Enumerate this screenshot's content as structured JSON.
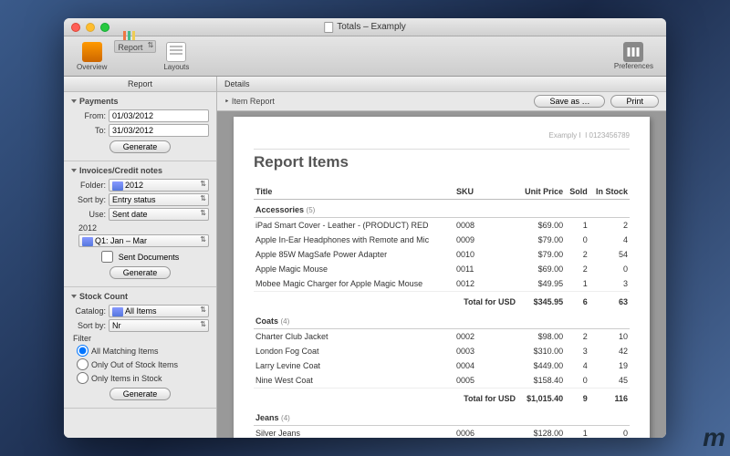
{
  "window": {
    "title": "Totals – Examply"
  },
  "toolbar": {
    "overview": "Overview",
    "report": "Report",
    "layouts": "Layouts",
    "preferences": "Preferences"
  },
  "sidebar": {
    "header": "Report",
    "payments": {
      "title": "Payments",
      "from_label": "From:",
      "from": "01/03/2012",
      "to_label": "To:",
      "to": "31/03/2012",
      "generate": "Generate"
    },
    "invoices": {
      "title": "Invoices/Credit notes",
      "folder_label": "Folder:",
      "folder": "2012",
      "sortby_label": "Sort by:",
      "sortby": "Entry status",
      "use_label": "Use:",
      "use": "Sent date",
      "year": "2012",
      "quarter": "Q1: Jan – Mar",
      "sent_docs": "Sent Documents",
      "generate": "Generate"
    },
    "stock": {
      "title": "Stock Count",
      "catalog_label": "Catalog:",
      "catalog": "All Items",
      "sortby_label": "Sort by:",
      "sortby": "Nr",
      "filter_label": "Filter",
      "opts": [
        "All Matching Items",
        "Only Out of Stock Items",
        "Only Items in Stock"
      ],
      "generate": "Generate"
    }
  },
  "details": {
    "header": "Details",
    "crumb": "Item Report",
    "save_as": "Save as …",
    "print": "Print"
  },
  "report": {
    "company": "Examply I",
    "company_no": "I 0123456789",
    "title": "Report Items",
    "cols": [
      "Title",
      "SKU",
      "Unit Price",
      "Sold",
      "In Stock"
    ],
    "total_label": "Total for USD",
    "groups": [
      {
        "name": "Accessories",
        "count": 5,
        "rows": [
          [
            "iPad Smart Cover - Leather - (PRODUCT) RED",
            "0008",
            "$69.00",
            "1",
            "2"
          ],
          [
            "Apple In-Ear Headphones with Remote and Mic",
            "0009",
            "$79.00",
            "0",
            "4"
          ],
          [
            "Apple 85W MagSafe Power Adapter",
            "0010",
            "$79.00",
            "2",
            "54"
          ],
          [
            "Apple Magic Mouse",
            "0011",
            "$69.00",
            "2",
            "0"
          ],
          [
            "Mobee Magic Charger for Apple Magic Mouse",
            "0012",
            "$49.95",
            "1",
            "3"
          ]
        ],
        "total": [
          "$345.95",
          "6",
          "63"
        ]
      },
      {
        "name": "Coats",
        "count": 4,
        "rows": [
          [
            "Charter Club Jacket",
            "0002",
            "$98.00",
            "2",
            "10"
          ],
          [
            "London Fog Coat",
            "0003",
            "$310.00",
            "3",
            "42"
          ],
          [
            "Larry Levine Coat",
            "0004",
            "$449.00",
            "4",
            "19"
          ],
          [
            "Nine West Coat",
            "0005",
            "$158.40",
            "0",
            "45"
          ]
        ],
        "total": [
          "$1,015.40",
          "9",
          "116"
        ]
      },
      {
        "name": "Jeans",
        "count": 4,
        "rows": [
          [
            "Silver Jeans",
            "0006",
            "$128.00",
            "1",
            "0"
          ]
        ],
        "total": null
      }
    ]
  }
}
